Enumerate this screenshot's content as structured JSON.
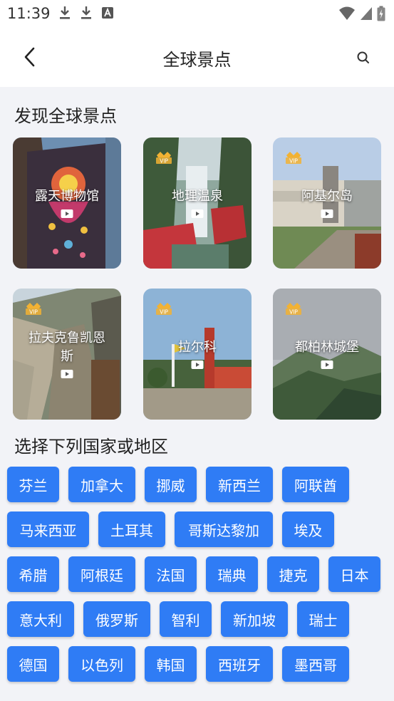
{
  "status_bar": {
    "time": "11:39"
  },
  "header": {
    "title": "全球景点"
  },
  "sections": {
    "discover_title": "发现全球景点",
    "select_title": "选择下列国家或地区"
  },
  "spots": [
    {
      "label": "露天博物馆",
      "vip": false
    },
    {
      "label": "地理温泉",
      "vip": true
    },
    {
      "label": "阿基尔岛",
      "vip": true
    },
    {
      "label": "拉夫克鲁凯恩斯",
      "vip": true
    },
    {
      "label": "拉尔科",
      "vip": true
    },
    {
      "label": "都柏林城堡",
      "vip": true
    }
  ],
  "vip_text": "VIP",
  "countries": [
    "芬兰",
    "加拿大",
    "挪威",
    "新西兰",
    "阿联酋",
    "马来西亚",
    "土耳其",
    "哥斯达黎加",
    "埃及",
    "希腊",
    "阿根廷",
    "法国",
    "瑞典",
    "捷克",
    "日本",
    "意大利",
    "俄罗斯",
    "智利",
    "新加坡",
    "瑞士",
    "德国",
    "以色列",
    "韩国",
    "西班牙",
    "墨西哥"
  ],
  "colors": {
    "accent": "#2f7cf5",
    "background": "#f2f3f7"
  }
}
